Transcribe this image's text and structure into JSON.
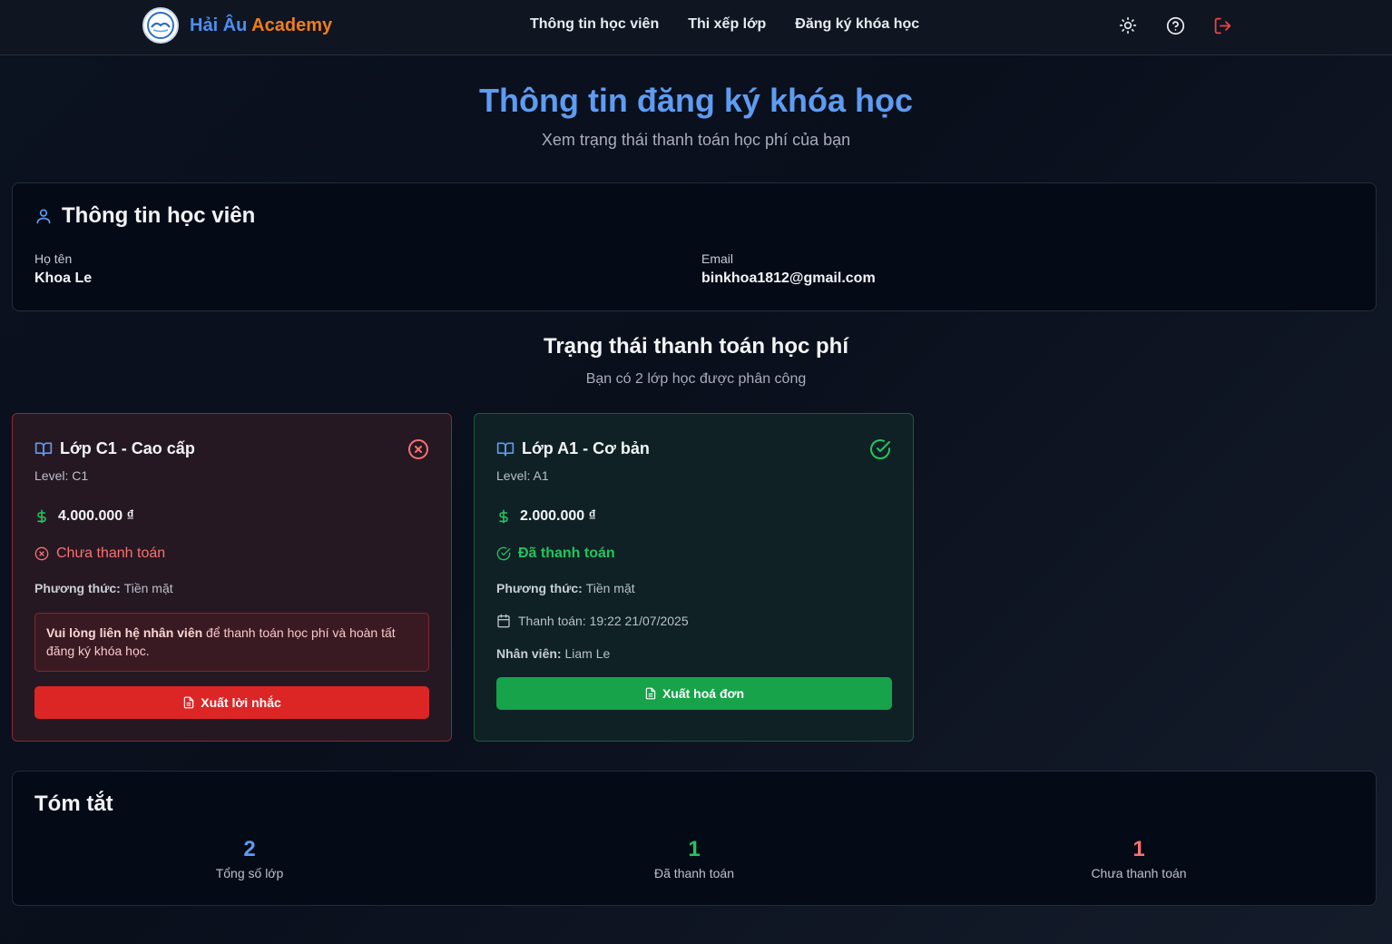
{
  "header": {
    "brand_part1": "Hải Âu",
    "brand_part2": "Academy",
    "nav": [
      "Thông tin học viên",
      "Thi xếp lớp",
      "Đăng ký khóa học"
    ],
    "icons": [
      "sun-icon",
      "help-circle-icon",
      "logout-icon"
    ]
  },
  "page": {
    "title": "Thông tin đăng ký khóa học",
    "subtitle": "Xem trạng thái thanh toán học phí của bạn"
  },
  "student": {
    "heading": "Thông tin học viên",
    "name_label": "Họ tên",
    "name": "Khoa Le",
    "email_label": "Email",
    "email": "binkhoa1812@gmail.com"
  },
  "payments": {
    "title": "Trạng thái thanh toán học phí",
    "subtitle": "Bạn có 2 lớp học được phân công",
    "courses": [
      {
        "name": "Lớp C1 - Cao cấp",
        "level": "Level: C1",
        "price": "4.000.000 ₫",
        "status": "Chưa thanh toán",
        "method_label": "Phương thức:",
        "method": "Tiền mặt",
        "notice_bold": "Vui lòng liên hệ nhân viên",
        "notice_rest": " để thanh toán học phí và hoàn tất đăng ký khóa học.",
        "button": "Xuất lời nhắc"
      },
      {
        "name": "Lớp A1 - Cơ bản",
        "level": "Level: A1",
        "price": "2.000.000 ₫",
        "status": "Đã thanh toán",
        "method_label": "Phương thức:",
        "method": "Tiền mặt",
        "paid_at": "Thanh toán: 19:22 21/07/2025",
        "staff_label": "Nhân viên:",
        "staff": "Liam Le",
        "button": "Xuất hoá đơn"
      }
    ]
  },
  "summary": {
    "heading": "Tóm tắt",
    "stats": [
      {
        "value": "2",
        "label": "Tổng số lớp"
      },
      {
        "value": "1",
        "label": "Đã thanh toán"
      },
      {
        "value": "1",
        "label": "Chưa thanh toán"
      }
    ]
  },
  "colors": {
    "accent_blue": "#5e9cf2",
    "paid_green": "#22c55e",
    "unpaid_red": "#f87171",
    "btn_red": "#dc2626",
    "btn_green": "#16a34a"
  }
}
